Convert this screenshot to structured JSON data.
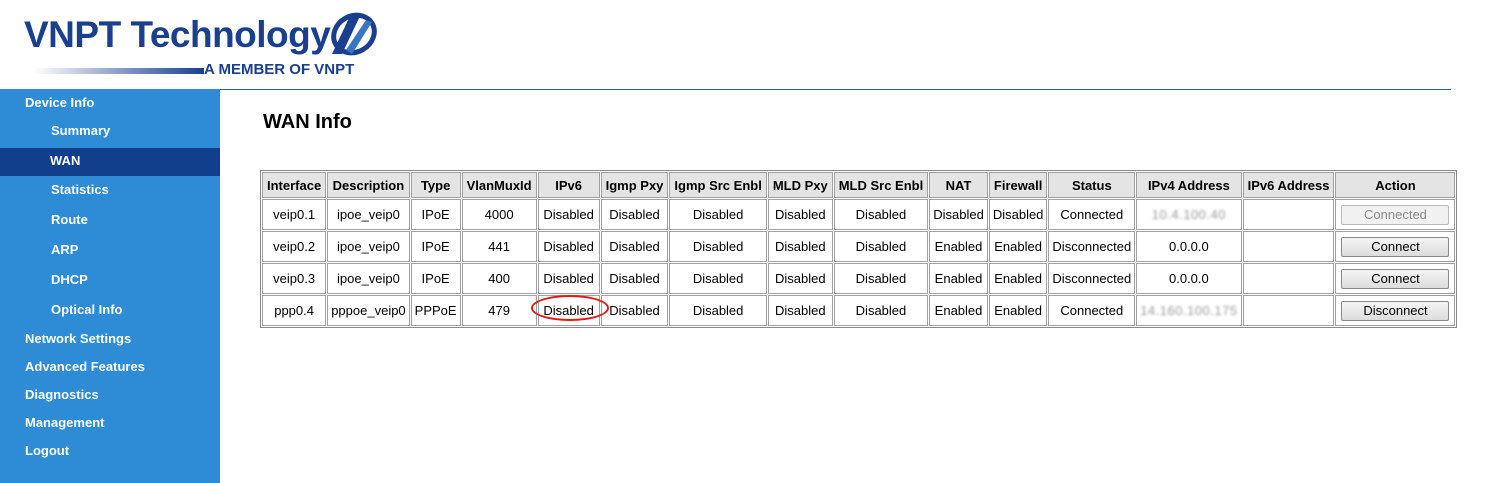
{
  "header": {
    "brand_title": "VNPT Technology",
    "brand_subtitle": "A MEMBER OF VNPT",
    "brand_color": "#1b3f8f"
  },
  "sidebar": {
    "background": "#2e8bd6",
    "active_background": "#123f8c",
    "items": [
      {
        "label": "Device Info",
        "level": "top"
      },
      {
        "label": "Summary",
        "level": "sub"
      },
      {
        "label": "WAN",
        "level": "sub",
        "active": true
      },
      {
        "label": "Statistics",
        "level": "sub"
      },
      {
        "label": "Route",
        "level": "sub"
      },
      {
        "label": "ARP",
        "level": "sub"
      },
      {
        "label": "DHCP",
        "level": "sub"
      },
      {
        "label": "Optical Info",
        "level": "sub"
      },
      {
        "label": "Network Settings",
        "level": "top"
      },
      {
        "label": "Advanced Features",
        "level": "top"
      },
      {
        "label": "Diagnostics",
        "level": "top"
      },
      {
        "label": "Management",
        "level": "top"
      },
      {
        "label": "Logout",
        "level": "top"
      }
    ]
  },
  "main": {
    "title": "WAN Info",
    "table": {
      "headers": [
        "Interface",
        "Description",
        "Type",
        "VlanMuxId",
        "IPv6",
        "Igmp Pxy",
        "Igmp Src Enbl",
        "MLD Pxy",
        "MLD Src Enbl",
        "NAT",
        "Firewall",
        "Status",
        "IPv4 Address",
        "IPv6 Address",
        "Action"
      ],
      "rows": [
        {
          "interface": "veip0.1",
          "description": "ipoe_veip0",
          "type": "IPoE",
          "vlanmuxid": "4000",
          "ipv6": "Disabled",
          "igmp_pxy": "Disabled",
          "igmp_src_enbl": "Disabled",
          "mld_pxy": "Disabled",
          "mld_src_enbl": "Disabled",
          "nat": "Disabled",
          "firewall": "Disabled",
          "status": "Connected",
          "ipv4": "10.4.100.40",
          "ipv4_blurred": true,
          "ipv6_address": "",
          "action": "Connected",
          "action_enabled": false
        },
        {
          "interface": "veip0.2",
          "description": "ipoe_veip0",
          "type": "IPoE",
          "vlanmuxid": "441",
          "ipv6": "Disabled",
          "igmp_pxy": "Disabled",
          "igmp_src_enbl": "Disabled",
          "mld_pxy": "Disabled",
          "mld_src_enbl": "Disabled",
          "nat": "Enabled",
          "firewall": "Enabled",
          "status": "Disconnected",
          "ipv4": "0.0.0.0",
          "ipv4_blurred": false,
          "ipv6_address": "",
          "action": "Connect",
          "action_enabled": true
        },
        {
          "interface": "veip0.3",
          "description": "ipoe_veip0",
          "type": "IPoE",
          "vlanmuxid": "400",
          "ipv6": "Disabled",
          "igmp_pxy": "Disabled",
          "igmp_src_enbl": "Disabled",
          "mld_pxy": "Disabled",
          "mld_src_enbl": "Disabled",
          "nat": "Enabled",
          "firewall": "Enabled",
          "status": "Disconnected",
          "ipv4": "0.0.0.0",
          "ipv4_blurred": false,
          "ipv6_address": "",
          "action": "Connect",
          "action_enabled": true
        },
        {
          "interface": "ppp0.4",
          "description": "pppoe_veip0",
          "type": "PPPoE",
          "vlanmuxid": "479",
          "ipv6": "Disabled",
          "ipv6_highlighted": true,
          "igmp_pxy": "Disabled",
          "igmp_src_enbl": "Disabled",
          "mld_pxy": "Disabled",
          "mld_src_enbl": "Disabled",
          "nat": "Enabled",
          "firewall": "Enabled",
          "status": "Connected",
          "ipv4": "14.160.100.175",
          "ipv4_blurred": true,
          "ipv6_address": "",
          "action": "Disconnect",
          "action_enabled": true
        }
      ]
    },
    "highlight_color": "#e01a1a"
  }
}
